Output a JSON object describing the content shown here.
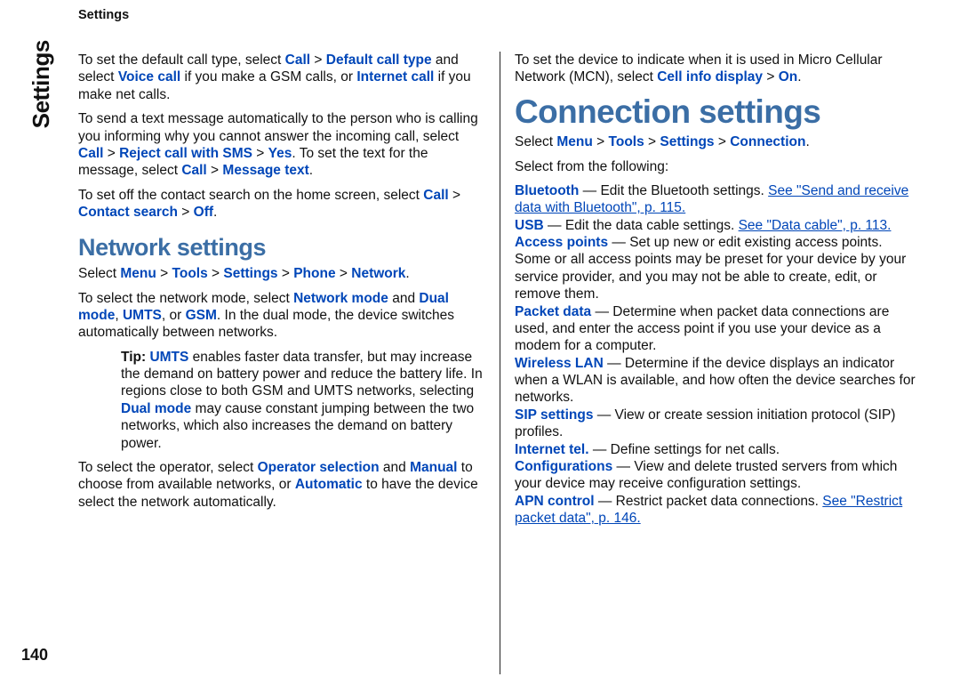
{
  "meta": {
    "side_tab": "Settings",
    "top_header": "Settings",
    "page_number": "140"
  },
  "left": {
    "p1": {
      "t0": "To set the default call type, select ",
      "k0": "Call",
      "sep0": "  >  ",
      "k1": "Default call type",
      "t1": " and select ",
      "k2": "Voice call",
      "t2": " if you make a GSM calls, or ",
      "k3": "Internet call",
      "t3": " if you make net calls."
    },
    "p2": {
      "t0": "To send a text message automatically to the person who is calling you informing why you cannot answer the incoming call, select ",
      "k0": "Call",
      "sep0": "  >  ",
      "k1": " Reject call with SMS",
      "sep1": "  >  ",
      "k2": "Yes",
      "t1": ". To set the text for the message, select ",
      "k3": "Call",
      "sep2": "  >  ",
      "k4": "Message text",
      "t2": "."
    },
    "p3": {
      "t0": "To set off the contact search on the home screen, select ",
      "k0": "Call",
      "sep0": "  >  ",
      "k1": "Contact search",
      "sep1": "  >  ",
      "k2": "Off",
      "t1": "."
    },
    "h1": "Network settings",
    "p4": {
      "t0": "Select ",
      "k0": "Menu",
      "sep0": "  >  ",
      "k1": "Tools",
      "sep1": "  >  ",
      "k2": "Settings",
      "sep2": "  >  ",
      "k3": "Phone",
      "sep3": "  >  ",
      "k4": "Network",
      "t1": "."
    },
    "p5": {
      "t0": "To select the network mode, select ",
      "k0": "Network mode",
      "t1": " and ",
      "k1": "Dual mode",
      "t2": ", ",
      "k2": "UMTS",
      "t3": ", or ",
      "k3": "GSM",
      "t4": ". In the dual mode, the device switches automatically between networks."
    },
    "tip": {
      "lead": "Tip: ",
      "k0": "UMTS",
      "t0": " enables faster data transfer, but may increase the demand on battery power and reduce the battery life. In regions close to both GSM and UMTS networks, selecting ",
      "k1": "Dual mode",
      "t1": " may cause constant jumping between the two networks, which also increases the demand on battery power."
    },
    "p6": {
      "t0": "To select the operator, select ",
      "k0": "Operator selection",
      "t1": " and ",
      "k1": "Manual",
      "t2": " to choose from available networks, or ",
      "k2": "Automatic",
      "t3": " to have the device select the network automatically."
    }
  },
  "right": {
    "p1": {
      "t0": "To set the device to indicate when it is used in Micro Cellular Network (MCN), select ",
      "k0": "Cell info display",
      "sep0": "  >  ",
      "k1": "On",
      "t1": "."
    },
    "h1": "Connection settings",
    "p2": {
      "t0": "Select ",
      "k0": "Menu",
      "sep0": "  >  ",
      "k1": "Tools",
      "sep1": "  >  ",
      "k2": "Settings",
      "sep2": "  >  ",
      "k3": "Connection",
      "t1": "."
    },
    "p3": "Select from the following:",
    "items": {
      "bt": {
        "k": "Bluetooth",
        "t": " — Edit the Bluetooth settings. ",
        "link": "See \"Send and receive data with Bluetooth\", p. 115."
      },
      "usb": {
        "k": "USB",
        "t": " — Edit the data cable settings. ",
        "link": "See \"Data cable\", p. 113."
      },
      "ap": {
        "k": "Access points",
        "t": " — Set up new or edit existing access points. Some or all access points may be preset for your device by your service provider, and you may not be able to create, edit, or remove them."
      },
      "pd": {
        "k": "Packet data",
        "t": " — Determine when packet data connections are used, and enter the access point if you use your device as a modem for a computer."
      },
      "wlan": {
        "k": "Wireless LAN",
        "t": " — Determine if the device displays an indicator when a WLAN is available, and how often the device searches for networks."
      },
      "sip": {
        "k": "SIP settings",
        "t": " — View or create session initiation protocol (SIP) profiles."
      },
      "itel": {
        "k": "Internet tel.",
        "t": " — Define settings for net calls."
      },
      "conf": {
        "k": "Configurations",
        "t": " — View and delete trusted servers from which your device may receive configuration settings."
      },
      "apn": {
        "k": "APN control",
        "t": " — Restrict packet data connections. ",
        "link": "See \"Restrict packet data\", p. 146."
      }
    }
  }
}
